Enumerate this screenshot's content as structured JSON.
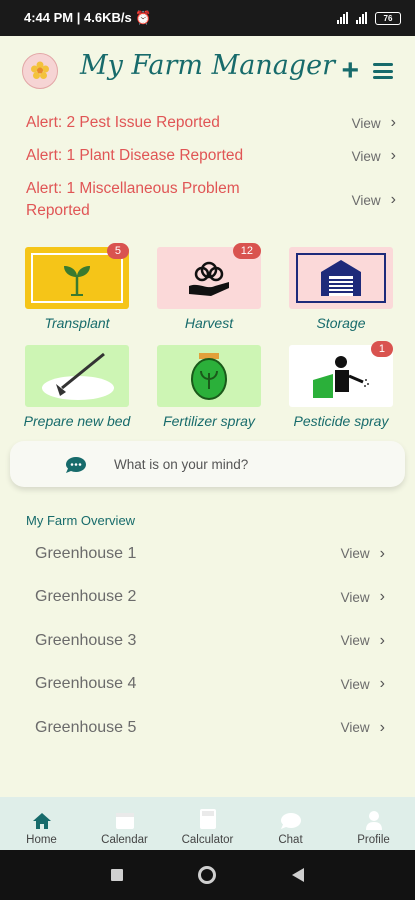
{
  "status_bar": {
    "time_info": "4:44 PM | 4.6KB/s ⏰",
    "battery": "76"
  },
  "header": {
    "title": "My Farm Manager",
    "add_icon": "plus-icon",
    "menu_icon": "hamburger-menu-icon"
  },
  "alerts": [
    {
      "text": "Alert: 2 Pest Issue Reported",
      "view": "View"
    },
    {
      "text": "Alert: 1 Plant Disease Reported",
      "view": "View"
    },
    {
      "text": "Alert: 1 Miscellaneous Problem Reported",
      "view": "View"
    }
  ],
  "tiles": [
    {
      "label": "Transplant",
      "badge": "5",
      "icon": "seedling-icon",
      "bg": "#f5c518"
    },
    {
      "label": "Harvest",
      "badge": "12",
      "icon": "hand-plant-icon",
      "bg": "#fbd9d9"
    },
    {
      "label": "Storage",
      "badge": "",
      "icon": "warehouse-icon",
      "bg": "#fbd9d9"
    },
    {
      "label": "Prepare new bed",
      "badge": "",
      "icon": "hoe-icon",
      "bg": "#cdf5b4"
    },
    {
      "label": "Fertilizer spray",
      "badge": "",
      "icon": "fertilizer-bag-icon",
      "bg": "#cdf5b4"
    },
    {
      "label": "Pesticide spray",
      "badge": "1",
      "icon": "sprayer-icon",
      "bg": "#ffffff"
    }
  ],
  "chat": {
    "placeholder": "What is on your mind?"
  },
  "overview": {
    "title": "My Farm Overview",
    "items": [
      {
        "name": "Greenhouse 1",
        "view": "View"
      },
      {
        "name": "Greenhouse 2",
        "view": "View"
      },
      {
        "name": "Greenhouse 3",
        "view": "View"
      },
      {
        "name": "Greenhouse 4",
        "view": "View"
      },
      {
        "name": "Greenhouse 5",
        "view": "View"
      }
    ]
  },
  "nav": [
    {
      "label": "Home",
      "icon": "home-icon"
    },
    {
      "label": "Calendar",
      "icon": "calendar-icon"
    },
    {
      "label": "Calculator",
      "icon": "calculator-icon"
    },
    {
      "label": "Chat",
      "icon": "chat-icon"
    },
    {
      "label": "Profile",
      "icon": "profile-icon"
    }
  ],
  "colors": {
    "accent": "#176b6b",
    "alert": "#e05555",
    "badge": "#d9534f",
    "background": "#f4f7e4"
  }
}
